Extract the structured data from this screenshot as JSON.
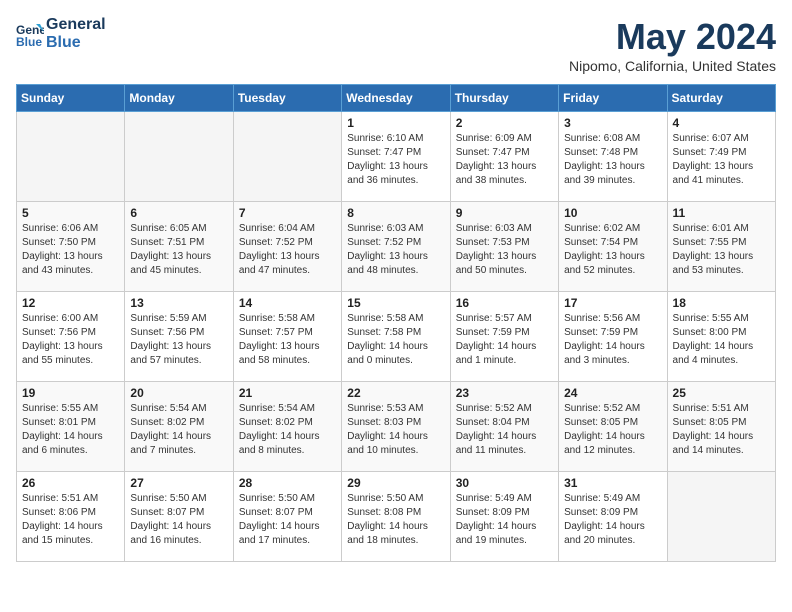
{
  "header": {
    "logo_line1": "General",
    "logo_line2": "Blue",
    "month_year": "May 2024",
    "location": "Nipomo, California, United States"
  },
  "weekdays": [
    "Sunday",
    "Monday",
    "Tuesday",
    "Wednesday",
    "Thursday",
    "Friday",
    "Saturday"
  ],
  "weeks": [
    [
      {
        "day": "",
        "info": ""
      },
      {
        "day": "",
        "info": ""
      },
      {
        "day": "",
        "info": ""
      },
      {
        "day": "1",
        "info": "Sunrise: 6:10 AM\nSunset: 7:47 PM\nDaylight: 13 hours\nand 36 minutes."
      },
      {
        "day": "2",
        "info": "Sunrise: 6:09 AM\nSunset: 7:47 PM\nDaylight: 13 hours\nand 38 minutes."
      },
      {
        "day": "3",
        "info": "Sunrise: 6:08 AM\nSunset: 7:48 PM\nDaylight: 13 hours\nand 39 minutes."
      },
      {
        "day": "4",
        "info": "Sunrise: 6:07 AM\nSunset: 7:49 PM\nDaylight: 13 hours\nand 41 minutes."
      }
    ],
    [
      {
        "day": "5",
        "info": "Sunrise: 6:06 AM\nSunset: 7:50 PM\nDaylight: 13 hours\nand 43 minutes."
      },
      {
        "day": "6",
        "info": "Sunrise: 6:05 AM\nSunset: 7:51 PM\nDaylight: 13 hours\nand 45 minutes."
      },
      {
        "day": "7",
        "info": "Sunrise: 6:04 AM\nSunset: 7:52 PM\nDaylight: 13 hours\nand 47 minutes."
      },
      {
        "day": "8",
        "info": "Sunrise: 6:03 AM\nSunset: 7:52 PM\nDaylight: 13 hours\nand 48 minutes."
      },
      {
        "day": "9",
        "info": "Sunrise: 6:03 AM\nSunset: 7:53 PM\nDaylight: 13 hours\nand 50 minutes."
      },
      {
        "day": "10",
        "info": "Sunrise: 6:02 AM\nSunset: 7:54 PM\nDaylight: 13 hours\nand 52 minutes."
      },
      {
        "day": "11",
        "info": "Sunrise: 6:01 AM\nSunset: 7:55 PM\nDaylight: 13 hours\nand 53 minutes."
      }
    ],
    [
      {
        "day": "12",
        "info": "Sunrise: 6:00 AM\nSunset: 7:56 PM\nDaylight: 13 hours\nand 55 minutes."
      },
      {
        "day": "13",
        "info": "Sunrise: 5:59 AM\nSunset: 7:56 PM\nDaylight: 13 hours\nand 57 minutes."
      },
      {
        "day": "14",
        "info": "Sunrise: 5:58 AM\nSunset: 7:57 PM\nDaylight: 13 hours\nand 58 minutes."
      },
      {
        "day": "15",
        "info": "Sunrise: 5:58 AM\nSunset: 7:58 PM\nDaylight: 14 hours\nand 0 minutes."
      },
      {
        "day": "16",
        "info": "Sunrise: 5:57 AM\nSunset: 7:59 PM\nDaylight: 14 hours\nand 1 minute."
      },
      {
        "day": "17",
        "info": "Sunrise: 5:56 AM\nSunset: 7:59 PM\nDaylight: 14 hours\nand 3 minutes."
      },
      {
        "day": "18",
        "info": "Sunrise: 5:55 AM\nSunset: 8:00 PM\nDaylight: 14 hours\nand 4 minutes."
      }
    ],
    [
      {
        "day": "19",
        "info": "Sunrise: 5:55 AM\nSunset: 8:01 PM\nDaylight: 14 hours\nand 6 minutes."
      },
      {
        "day": "20",
        "info": "Sunrise: 5:54 AM\nSunset: 8:02 PM\nDaylight: 14 hours\nand 7 minutes."
      },
      {
        "day": "21",
        "info": "Sunrise: 5:54 AM\nSunset: 8:02 PM\nDaylight: 14 hours\nand 8 minutes."
      },
      {
        "day": "22",
        "info": "Sunrise: 5:53 AM\nSunset: 8:03 PM\nDaylight: 14 hours\nand 10 minutes."
      },
      {
        "day": "23",
        "info": "Sunrise: 5:52 AM\nSunset: 8:04 PM\nDaylight: 14 hours\nand 11 minutes."
      },
      {
        "day": "24",
        "info": "Sunrise: 5:52 AM\nSunset: 8:05 PM\nDaylight: 14 hours\nand 12 minutes."
      },
      {
        "day": "25",
        "info": "Sunrise: 5:51 AM\nSunset: 8:05 PM\nDaylight: 14 hours\nand 14 minutes."
      }
    ],
    [
      {
        "day": "26",
        "info": "Sunrise: 5:51 AM\nSunset: 8:06 PM\nDaylight: 14 hours\nand 15 minutes."
      },
      {
        "day": "27",
        "info": "Sunrise: 5:50 AM\nSunset: 8:07 PM\nDaylight: 14 hours\nand 16 minutes."
      },
      {
        "day": "28",
        "info": "Sunrise: 5:50 AM\nSunset: 8:07 PM\nDaylight: 14 hours\nand 17 minutes."
      },
      {
        "day": "29",
        "info": "Sunrise: 5:50 AM\nSunset: 8:08 PM\nDaylight: 14 hours\nand 18 minutes."
      },
      {
        "day": "30",
        "info": "Sunrise: 5:49 AM\nSunset: 8:09 PM\nDaylight: 14 hours\nand 19 minutes."
      },
      {
        "day": "31",
        "info": "Sunrise: 5:49 AM\nSunset: 8:09 PM\nDaylight: 14 hours\nand 20 minutes."
      },
      {
        "day": "",
        "info": ""
      }
    ]
  ]
}
